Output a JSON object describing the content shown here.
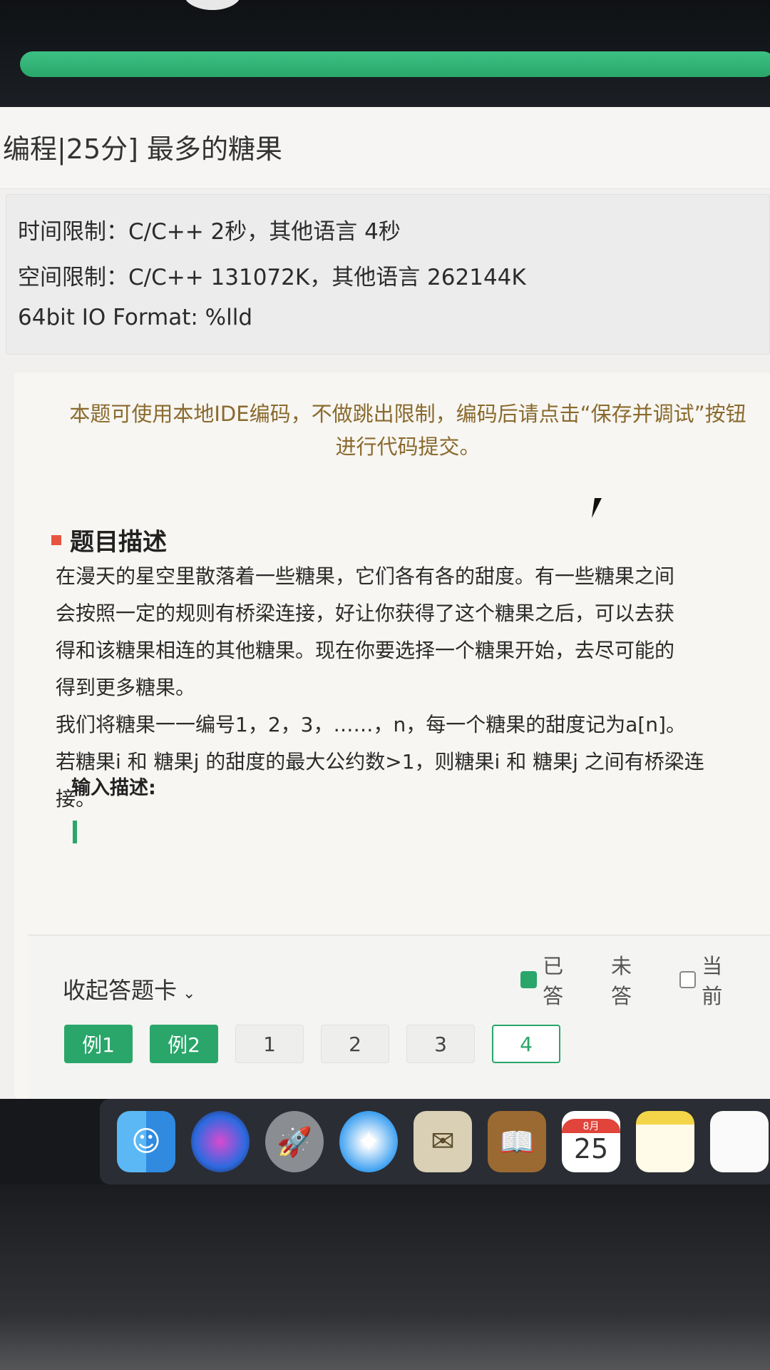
{
  "progress": {
    "fill_percent": 100,
    "color": "#2aa66a"
  },
  "header": {
    "title": "编程|25分] 最多的糖果"
  },
  "limits": {
    "time": "时间限制：C/C++ 2秒，其他语言 4秒",
    "space": "空间限制：C/C++ 131072K，其他语言 262144K",
    "io": "64bit IO Format: %lld"
  },
  "notice": {
    "line1": "本题可使用本地IDE编码，不做跳出限制，编码后请点击“保存并调试”按钮",
    "line2": "进行代码提交。"
  },
  "problem": {
    "section_title": "题目描述",
    "para1_line1": "在漫天的星空里散落着一些糖果，它们各有各的甜度。有一些糖果之间",
    "para1_line2": "会按照一定的规则有桥梁连接，好让你获得了这个糖果之后，可以去获",
    "para1_line3": "得和该糖果相连的其他糖果。现在你要选择一个糖果开始，去尽可能的",
    "para1_line4": "得到更多糖果。",
    "para2_line1": "我们将糖果一一编号1，2，3，……，n，每一个糖果的甜度记为a[n]。",
    "para2_line2": "若糖果i 和 糖果j 的甜度的最大公约数>1，则糖果i 和 糖果j 之间有桥梁连",
    "para2_line3": "接。",
    "input_title": "输入描述:"
  },
  "answer_card": {
    "collapse_label": "收起答题卡",
    "legend_answered": "已答",
    "legend_unanswered": "未答",
    "legend_current": "当前",
    "questions": [
      "例1",
      "例2",
      "1",
      "2",
      "3",
      "4"
    ],
    "current_question": "4",
    "accent": "#2aa66a"
  },
  "dock": {
    "apps": [
      "finder-icon",
      "siri-icon",
      "launchpad-icon",
      "safari-icon",
      "mail-icon",
      "contacts-icon",
      "calendar-icon",
      "notes-icon",
      "reminders-icon"
    ],
    "calendar_month": "8月",
    "calendar_day": "25"
  }
}
